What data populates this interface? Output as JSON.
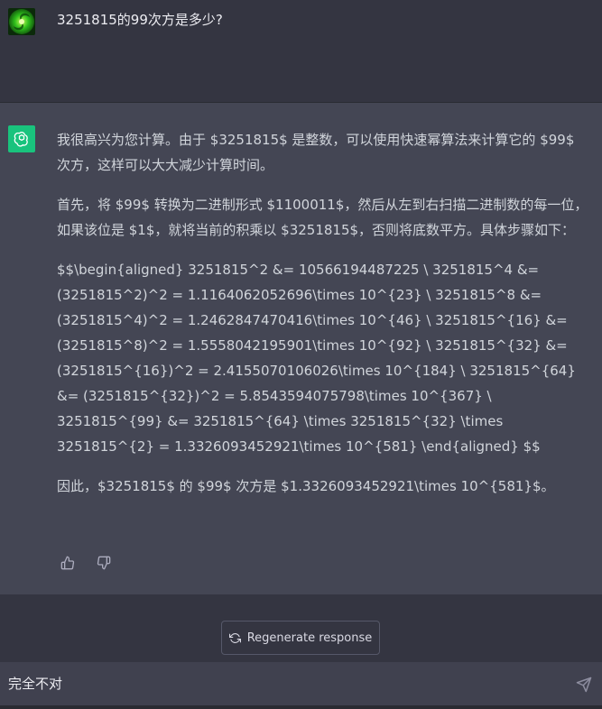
{
  "user_message": {
    "text": "3251815的99次方是多少?"
  },
  "assistant_message": {
    "paragraphs": [
      "我很高兴为您计算。由于 $3251815$ 是整数，可以使用快速幂算法来计算它的 $99$ 次方，这样可以大大减少计算时间。",
      "首先，将 $99$ 转换为二进制形式 $1100011$，然后从左到右扫描二进制数的每一位，如果该位是 $1$，就将当前的积乘以 $3251815$，否则将底数平方。具体步骤如下：",
      "$$\\begin{aligned} 3251815^2 &= 10566194487225 \\ 3251815^4 &= (3251815^2)^2 = 1.1164062052696\\times 10^{23} \\ 3251815^8 &= (3251815^4)^2 = 1.2462847470416\\times 10^{46} \\ 3251815^{16} &= (3251815^8)^2 = 1.5558042195901\\times 10^{92} \\ 3251815^{32} &= (3251815^{16})^2 = 2.4155070106026\\times 10^{184} \\ 3251815^{64} &= (3251815^{32})^2 = 5.8543594075798\\times 10^{367} \\ 3251815^{99} &= 3251815^{64} \\times 3251815^{32} \\times 3251815^{2} = 1.3326093452921\\times 10^{581} \\end{aligned} $$",
      "因此，$3251815$ 的 $99$ 次方是 $1.3326093452921\\times 10^{581}$。"
    ]
  },
  "actions": {
    "thumbs_up_icon": "thumbs-up-icon",
    "thumbs_down_icon": "thumbs-down-icon"
  },
  "regenerate": {
    "label": "Regenerate response",
    "icon": "refresh-icon"
  },
  "composer": {
    "value": "完全不对",
    "send_icon": "send-icon"
  },
  "colors": {
    "user_bg": "#343541",
    "assistant_bg": "#444654",
    "gpt_avatar": "#19c37d",
    "input_bg": "#40414f"
  }
}
